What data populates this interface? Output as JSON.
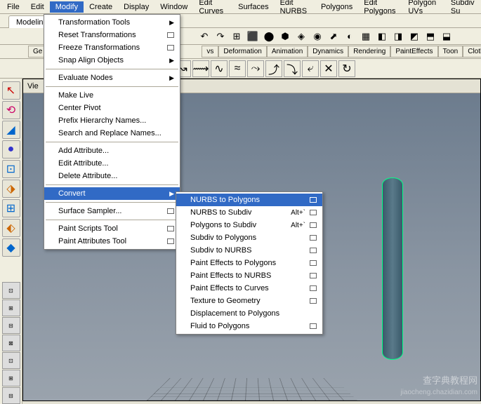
{
  "menubar": [
    "File",
    "Edit",
    "Modify",
    "Create",
    "Display",
    "Window",
    "Edit Curves",
    "Surfaces",
    "Edit NURBS",
    "Polygons",
    "Edit Polygons",
    "Polygon UVs",
    "Subdiv Su"
  ],
  "active_menu_index": 2,
  "primary_tab": "Modeling",
  "shelf_tabs_right": [
    "vs",
    "Deformation",
    "Animation",
    "Dynamics",
    "Rendering",
    "PaintEffects",
    "Toon",
    "Cloth"
  ],
  "shelf_tab_left": "Ge",
  "viewport_tab": "Vie",
  "modify_menu": {
    "groups": [
      [
        {
          "label": "Transformation Tools",
          "arrow": true
        },
        {
          "label": "Reset Transformations",
          "box": true
        },
        {
          "label": "Freeze Transformations",
          "box": true
        },
        {
          "label": "Snap Align Objects",
          "arrow": true
        }
      ],
      [
        {
          "label": "Evaluate Nodes",
          "arrow": true
        }
      ],
      [
        {
          "label": "Make Live"
        },
        {
          "label": "Center Pivot"
        },
        {
          "label": "Prefix Hierarchy Names..."
        },
        {
          "label": "Search and Replace Names..."
        }
      ],
      [
        {
          "label": "Add Attribute..."
        },
        {
          "label": "Edit Attribute..."
        },
        {
          "label": "Delete Attribute..."
        }
      ],
      [
        {
          "label": "Convert",
          "arrow": true,
          "hl": true
        }
      ],
      [
        {
          "label": "Surface Sampler...",
          "box": true
        }
      ],
      [
        {
          "label": "Paint Scripts Tool",
          "box": true
        },
        {
          "label": "Paint Attributes Tool",
          "box": true
        }
      ]
    ]
  },
  "convert_submenu": [
    {
      "label": "NURBS to Polygons",
      "box": true,
      "hl": true
    },
    {
      "label": "NURBS to Subdiv",
      "short": "Alt+`",
      "box": true
    },
    {
      "label": "Polygons to Subdiv",
      "short": "Alt+`",
      "box": true
    },
    {
      "label": "Subdiv to Polygons",
      "box": true
    },
    {
      "label": "Subdiv to NURBS",
      "box": true
    },
    {
      "label": "Paint Effects to Polygons",
      "box": true
    },
    {
      "label": "Paint Effects to NURBS",
      "box": true
    },
    {
      "label": "Paint Effects to Curves",
      "box": true
    },
    {
      "label": "Texture to Geometry",
      "box": true
    },
    {
      "label": "Displacement to Polygons"
    },
    {
      "label": "Fluid to Polygons",
      "box": true
    }
  ],
  "toolbar_icons": [
    "↶",
    "↷",
    "⊞",
    "⬛",
    "⬤",
    "⬢",
    "◈",
    "◉",
    "⬈",
    "◐",
    "▦",
    "◧",
    "◨",
    "◩",
    "⬒",
    "⬓"
  ],
  "curve_icons": [
    "↝",
    "⟿",
    "∿",
    "≈",
    "⤳",
    "⤴",
    "⤵",
    "⤶",
    "✕",
    "↻"
  ],
  "left_tools": [
    "↖",
    "⟲",
    "◢",
    "●",
    "⊡",
    "⬗",
    "⊞",
    "⬖",
    "◆"
  ],
  "shelf_buttons": [
    "⊡",
    "⊞",
    "⊟",
    "⊠",
    "⊡",
    "⊞",
    "⊟"
  ],
  "watermark": "查字典教程网",
  "watermark2": "jiaocheng.chazidian.com"
}
